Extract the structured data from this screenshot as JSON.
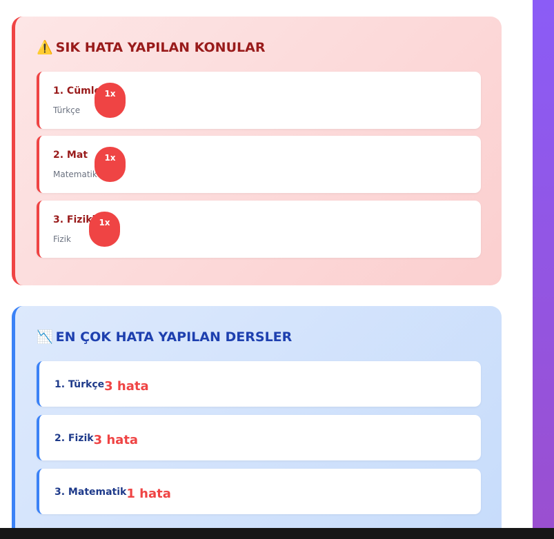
{
  "frequent_topics": {
    "icon": "warning-icon",
    "icon_glyph": "⚠️",
    "title": "SIK HATA YAPILAN KONULAR",
    "items": [
      {
        "name": "1. Cümle",
        "subject": "Türkçe",
        "count": "1x"
      },
      {
        "name": "2. Mat",
        "subject": "Matematik",
        "count": "1x"
      },
      {
        "name": "3. Fizikl",
        "subject": "Fizik",
        "count": "1x"
      }
    ]
  },
  "frequent_subjects": {
    "icon": "chart-decreasing-icon",
    "icon_glyph": "📉",
    "title": "EN ÇOK HATA YAPILAN DERSLER",
    "items": [
      {
        "name": "1. Türkçe",
        "count": "3 hata"
      },
      {
        "name": "2. Fizik",
        "count": "3 hata"
      },
      {
        "name": "3. Matematik",
        "count": "1 hata"
      }
    ]
  },
  "colors": {
    "red_accent": "#ef4444",
    "red_text": "#991b1b",
    "blue_accent": "#3b82f6",
    "blue_text": "#1e40af",
    "sidebar_purple": "#8b5cf6"
  }
}
